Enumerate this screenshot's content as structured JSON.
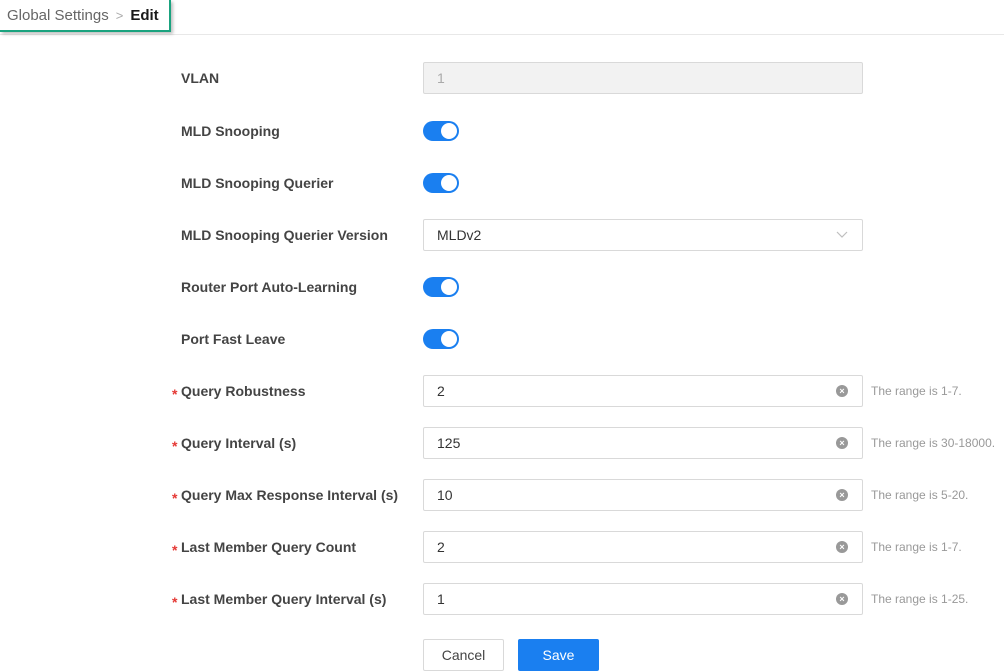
{
  "breadcrumb": {
    "parent": "Global Settings",
    "separator": ">",
    "current": "Edit"
  },
  "form": {
    "vlan": {
      "label": "VLAN",
      "value": "1"
    },
    "mld_snooping": {
      "label": "MLD Snooping",
      "enabled": true
    },
    "mld_snooping_querier": {
      "label": "MLD Snooping Querier",
      "enabled": true
    },
    "querier_version": {
      "label": "MLD Snooping Querier Version",
      "value": "MLDv2"
    },
    "router_port_auto_learning": {
      "label": "Router Port Auto-Learning",
      "enabled": true
    },
    "port_fast_leave": {
      "label": "Port Fast Leave",
      "enabled": true
    },
    "query_robustness": {
      "label": "Query Robustness",
      "value": "2",
      "hint": "The range is 1-7.",
      "required_mark": "*"
    },
    "query_interval": {
      "label": "Query Interval (s)",
      "value": "125",
      "hint": "The range is 30-18000.",
      "required_mark": "*"
    },
    "query_max_response_interval": {
      "label": "Query Max Response Interval (s)",
      "value": "10",
      "hint": "The range is 5-20.",
      "required_mark": "*"
    },
    "last_member_query_count": {
      "label": "Last Member Query Count",
      "value": "2",
      "hint": "The range is 1-7.",
      "required_mark": "*"
    },
    "last_member_query_interval": {
      "label": "Last Member Query Interval (s)",
      "value": "1",
      "hint": "The range is 1-25.",
      "required_mark": "*"
    }
  },
  "buttons": {
    "cancel": "Cancel",
    "save": "Save"
  },
  "colors": {
    "accent": "#1a7ff0",
    "required": "#e53935",
    "highlight_border": "#1aa37f"
  },
  "icons": {
    "breadcrumb_separator": "chevron-right-icon",
    "clear": "clear-circle-icon",
    "dropdown": "chevron-down-icon"
  }
}
